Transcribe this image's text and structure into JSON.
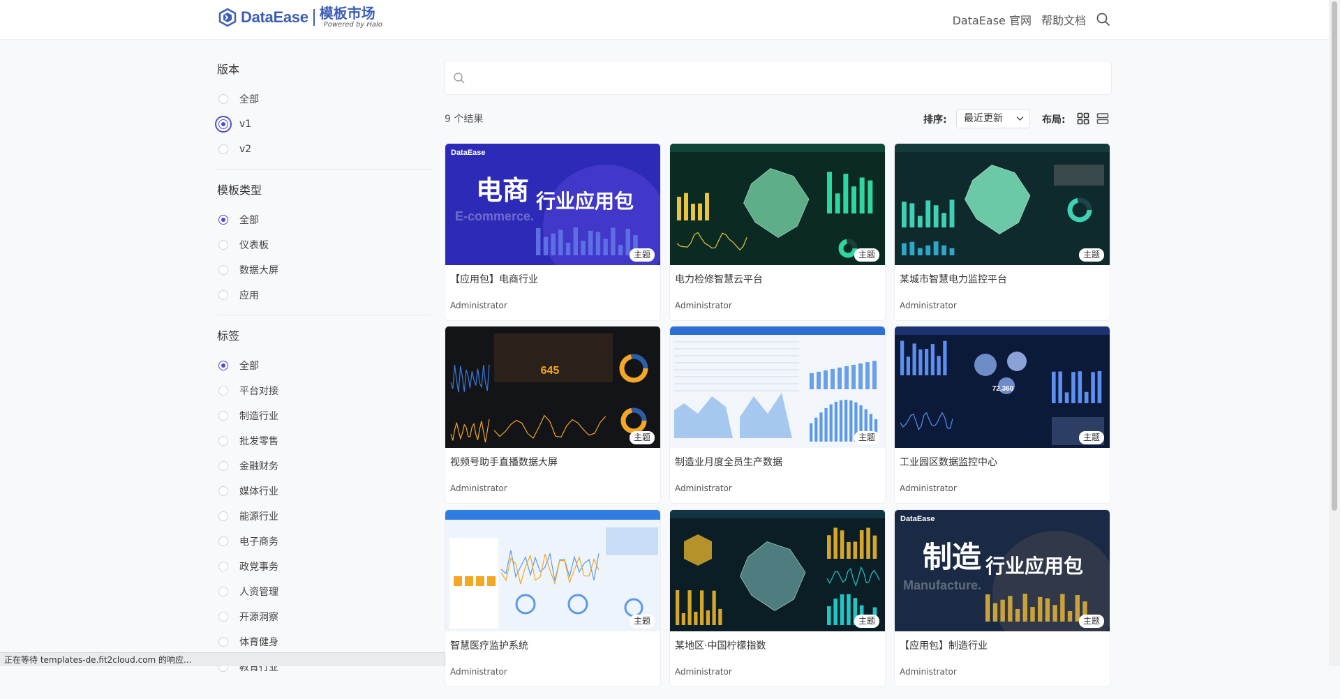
{
  "header": {
    "logo_name": "DataEase",
    "logo_title": "模板市场",
    "logo_sub": "Powered by Halo",
    "nav": [
      "DataEase 官网",
      "帮助文档"
    ]
  },
  "sidebar": {
    "groups": [
      {
        "title": "版本",
        "options": [
          {
            "label": "全部",
            "checked": false
          },
          {
            "label": "v1",
            "checked": true
          },
          {
            "label": "v2",
            "checked": false
          }
        ]
      },
      {
        "title": "模板类型",
        "options": [
          {
            "label": "全部",
            "checked": true
          },
          {
            "label": "仪表板",
            "checked": false
          },
          {
            "label": "数据大屏",
            "checked": false
          },
          {
            "label": "应用",
            "checked": false
          }
        ]
      },
      {
        "title": "标签",
        "options": [
          {
            "label": "全部",
            "checked": true
          },
          {
            "label": "平台对接",
            "checked": false
          },
          {
            "label": "制造行业",
            "checked": false
          },
          {
            "label": "批发零售",
            "checked": false
          },
          {
            "label": "金融财务",
            "checked": false
          },
          {
            "label": "媒体行业",
            "checked": false
          },
          {
            "label": "能源行业",
            "checked": false
          },
          {
            "label": "电子商务",
            "checked": false
          },
          {
            "label": "政党事务",
            "checked": false
          },
          {
            "label": "人资管理",
            "checked": false
          },
          {
            "label": "开源洞察",
            "checked": false
          },
          {
            "label": "体育健身",
            "checked": false
          },
          {
            "label": "教育行业",
            "checked": false
          }
        ]
      }
    ]
  },
  "main": {
    "search_placeholder": "",
    "result_count": "9 个结果",
    "sort_label": "排序:",
    "sort_value": "最近更新",
    "layout_label": "布局:"
  },
  "cards": [
    {
      "title": "【应用包】电商行业",
      "author": "Administrator",
      "badge": "主题",
      "thumb_title": "DataEase",
      "big_text": "电商",
      "small_text": "行业应用包",
      "en_text": "E-commerce."
    },
    {
      "title": "电力检修智慧云平台",
      "author": "Administrator",
      "badge": "主题"
    },
    {
      "title": "某城市智慧电力监控平台",
      "author": "Administrator",
      "badge": "主题"
    },
    {
      "title": "视频号助手直播数据大屏",
      "author": "Administrator",
      "badge": "主题",
      "value": "645"
    },
    {
      "title": "制造业月度全员生产数据",
      "author": "Administrator",
      "badge": "主题"
    },
    {
      "title": "工业园区数据监控中心",
      "author": "Administrator",
      "badge": "主题",
      "value": "72,360"
    },
    {
      "title": "智慧医疗监护系统",
      "author": "Administrator",
      "badge": "主题"
    },
    {
      "title": "某地区·中国柠檬指数",
      "author": "Administrator",
      "badge": "主题"
    },
    {
      "title": "【应用包】制造行业",
      "author": "Administrator",
      "badge": "主题",
      "thumb_title": "DataEase",
      "big_text": "制造",
      "small_text": "行业应用包",
      "en_text": "Manufacture."
    }
  ],
  "status_text": "正在等待 templates-de.fit2cloud.com 的响应...",
  "colors": {
    "accent": "#4b4bd6",
    "brand": "#3d5eb8"
  }
}
